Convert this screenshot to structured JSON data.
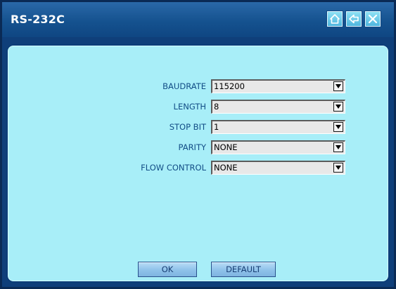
{
  "window": {
    "title": "RS-232C"
  },
  "titlebar_buttons": {
    "home_icon": "home-icon",
    "back_icon": "back-arrow-icon",
    "close_icon": "close-icon"
  },
  "settings": [
    {
      "label": "BAUDRATE",
      "value": "115200"
    },
    {
      "label": "LENGTH",
      "value": "8"
    },
    {
      "label": "STOP BIT",
      "value": "1"
    },
    {
      "label": "PARITY",
      "value": "NONE"
    },
    {
      "label": "FLOW CONTROL",
      "value": "NONE"
    }
  ],
  "buttons": {
    "ok_label": "OK",
    "default_label": "DEFAULT"
  },
  "colors": {
    "titlebar": "#15528f",
    "panel_background": "#a8eef8",
    "label_text": "#124d86",
    "accent_button": "#8fc2ea"
  }
}
